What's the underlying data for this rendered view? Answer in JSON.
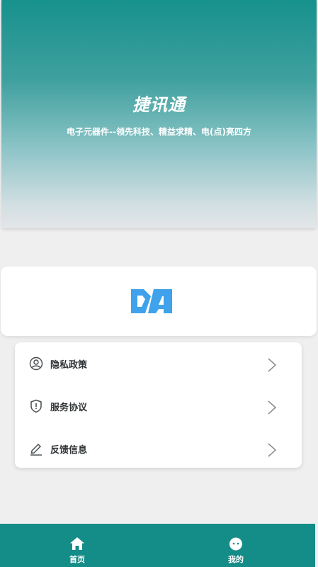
{
  "hero": {
    "title": "捷讯通",
    "subtitle": "电子元器件--领先科技、精益求精、电(点)亮四方"
  },
  "logo": {
    "name": "DA-logo",
    "color": "#3fa2ea"
  },
  "menu": {
    "items": [
      {
        "label": "隐私政策",
        "icon": "user-icon"
      },
      {
        "label": "服务协议",
        "icon": "shield-icon"
      },
      {
        "label": "反馈信息",
        "icon": "pencil-icon"
      }
    ]
  },
  "tabbar": {
    "color": "#148c87",
    "tabs": [
      {
        "label": "首页",
        "icon": "home-icon"
      },
      {
        "label": "我的",
        "icon": "profile-face-icon"
      }
    ]
  }
}
